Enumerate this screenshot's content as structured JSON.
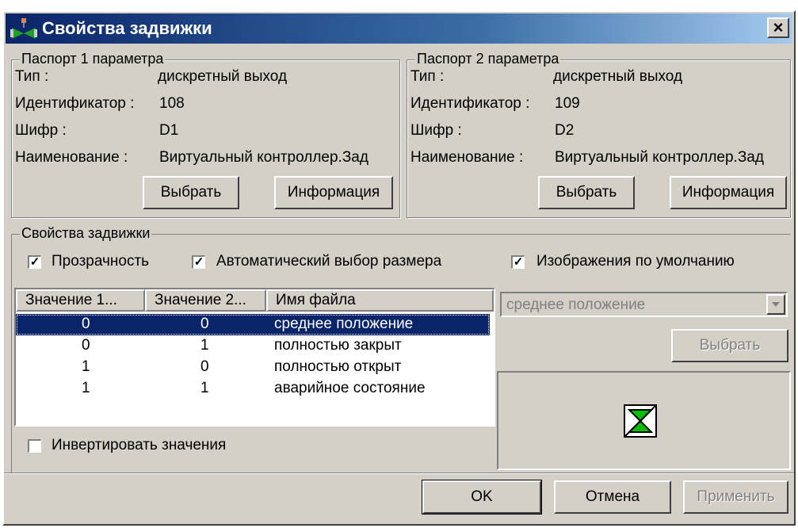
{
  "window": {
    "title": "Свойства задвижки",
    "close_label": "×"
  },
  "passport1": {
    "caption": "Паспорт 1 параметра",
    "type_label": "Тип :",
    "type_value": "дискретный выход",
    "id_label": "Идентификатор :",
    "id_value": "108",
    "code_label": "Шифр :",
    "code_value": "D1",
    "name_label": "Наименование :",
    "name_value": "Виртуальный контроллер.Зад",
    "select_label": "Выбрать",
    "info_label": "Информация"
  },
  "passport2": {
    "caption": "Паспорт 2 параметра",
    "type_label": "Тип :",
    "type_value": "дискретный выход",
    "id_label": "Идентификатор :",
    "id_value": "109",
    "code_label": "Шифр :",
    "code_value": "D2",
    "name_label": "Наименование :",
    "name_value": "Виртуальный контроллер.Зад",
    "select_label": "Выбрать",
    "info_label": "Информация"
  },
  "props": {
    "caption": "Свойства задвижки",
    "transparency": {
      "label": "Прозрачность",
      "checked": true
    },
    "autosize": {
      "label": "Автоматический выбор размера",
      "checked": true
    },
    "default_images": {
      "label": "Изображения по умолчанию",
      "checked": true
    },
    "invert": {
      "label": "Инвертировать значения",
      "checked": false
    },
    "columns": [
      "Значение 1...",
      "Значение 2...",
      "Имя файла"
    ],
    "rows": [
      {
        "v1": "0",
        "v2": "0",
        "file": "среднее положение",
        "selected": true
      },
      {
        "v1": "0",
        "v2": "1",
        "file": "полностью закрыт",
        "selected": false
      },
      {
        "v1": "1",
        "v2": "0",
        "file": "полностью открыт",
        "selected": false
      },
      {
        "v1": "1",
        "v2": "1",
        "file": "аварийное состояние",
        "selected": false
      }
    ],
    "combo_value": "среднее положение",
    "image_select_label": "Выбрать",
    "preview_icon": "valve-icon"
  },
  "footer": {
    "ok_label": "OK",
    "cancel_label": "Отмена",
    "apply_label": "Применить"
  },
  "colors": {
    "selection": "#0a246a",
    "valve_green": "#00c000",
    "face": "#d4d0c8"
  }
}
